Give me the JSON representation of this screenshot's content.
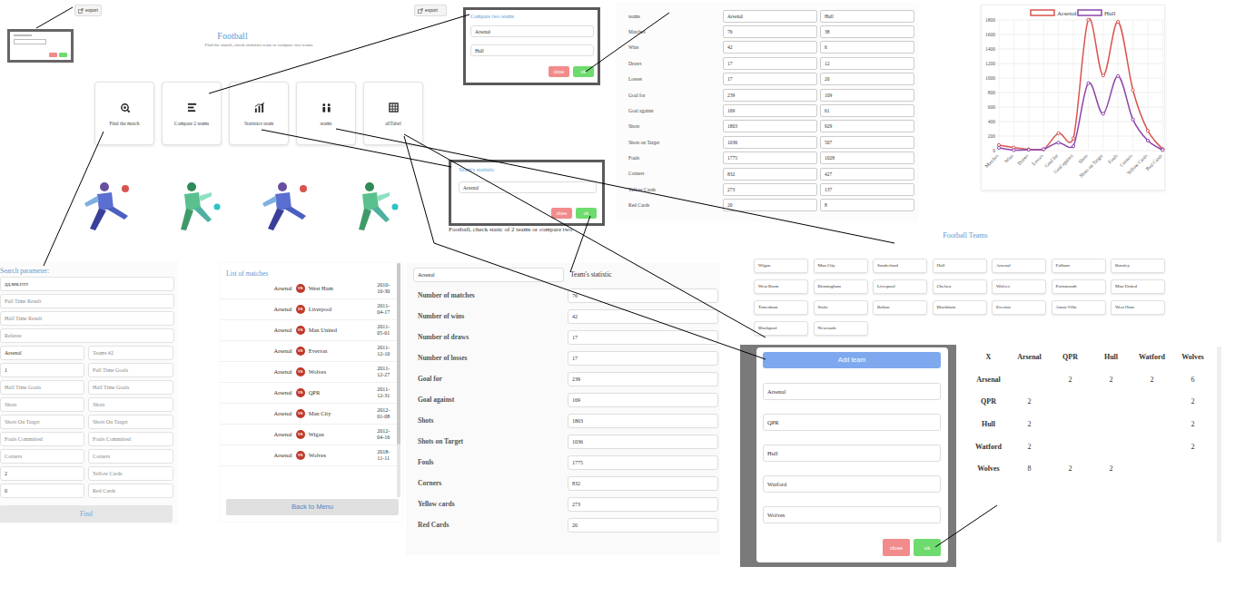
{
  "export_buttons": [
    "export",
    "export"
  ],
  "menu": {
    "title": "Football",
    "subtitle": "Find the match, check statistics team or compare two teams",
    "cards": [
      "Find the match",
      "Compare 2 teams",
      "Statistics team",
      "teams",
      "allTabel"
    ]
  },
  "compare_dialog": {
    "title": "Compare two teams",
    "fields": [
      "Arsenal",
      "Hull"
    ],
    "buttons": [
      "close",
      "ok"
    ]
  },
  "compare_table": {
    "rows": [
      {
        "label": "teams",
        "values": [
          "Arsenal",
          "Hull"
        ]
      },
      {
        "label": "Matches",
        "values": [
          "76",
          "38"
        ]
      },
      {
        "label": "Wins",
        "values": [
          "42",
          "6"
        ]
      },
      {
        "label": "Draws",
        "values": [
          "17",
          "12"
        ]
      },
      {
        "label": "Losses",
        "values": [
          "17",
          "20"
        ]
      },
      {
        "label": "Goal for",
        "values": [
          "239",
          "109"
        ]
      },
      {
        "label": "Goal against",
        "values": [
          "169",
          "61"
        ]
      },
      {
        "label": "Shots",
        "values": [
          "1803",
          "929"
        ]
      },
      {
        "label": "Shots on Target",
        "values": [
          "1036",
          "507"
        ]
      },
      {
        "label": "Fouls",
        "values": [
          "1775",
          "1028"
        ]
      },
      {
        "label": "Corners",
        "values": [
          "832",
          "427"
        ]
      },
      {
        "label": "Yellow Cards",
        "values": [
          "273",
          "137"
        ]
      },
      {
        "label": "Red Cards",
        "values": [
          "20",
          "8"
        ]
      }
    ]
  },
  "chart": {
    "y_ticks": [
      "0",
      "200",
      "400",
      "600",
      "800",
      "1000",
      "1200",
      "1400",
      "1600",
      "1800"
    ],
    "categories": [
      "Matches",
      "Wins",
      "Draws",
      "Losses",
      "Goal for",
      "Goal against",
      "Shots",
      "Shots on Target",
      "Fouls",
      "Corners",
      "Yellow Cards",
      "Red Cards"
    ],
    "series": [
      {
        "name": "Arsenal",
        "color": "#d9534f",
        "values": [
          76,
          42,
          17,
          17,
          239,
          169,
          1803,
          1036,
          1775,
          832,
          273,
          20
        ]
      },
      {
        "name": "Hull",
        "color": "#8e44ad",
        "values": [
          38,
          6,
          12,
          20,
          109,
          61,
          929,
          507,
          1028,
          427,
          137,
          8
        ]
      }
    ]
  },
  "stat_dialog": {
    "title": "Team's statistic",
    "field": "Arsenal",
    "buttons": [
      "close",
      "ok"
    ],
    "behind_text": "Football, check static of 2 teams or compare two"
  },
  "search": {
    "title": "Search parameter:",
    "wide_fields": [
      {
        "value": "дд.мм.гггг"
      },
      {
        "placeholder": "Full Time Result"
      },
      {
        "placeholder": "Half Time Result"
      },
      {
        "placeholder": "Referee"
      }
    ],
    "pairs": [
      [
        {
          "value": "Arsenal"
        },
        {
          "placeholder": "Teams #2"
        }
      ],
      [
        {
          "value": "1"
        },
        {
          "placeholder": "Full Time Goals"
        }
      ],
      [
        {
          "placeholder": "Half Time Goals"
        },
        {
          "placeholder": "Half Time Goals"
        }
      ],
      [
        {
          "placeholder": "Shots"
        },
        {
          "placeholder": "Shots"
        }
      ],
      [
        {
          "placeholder": "Shots On Target"
        },
        {
          "placeholder": "Shots On Target"
        }
      ],
      [
        {
          "placeholder": "Fouls Committed"
        },
        {
          "placeholder": "Fouls Committed"
        }
      ],
      [
        {
          "placeholder": "Corners"
        },
        {
          "placeholder": "Corners"
        }
      ],
      [
        {
          "value": "2"
        },
        {
          "placeholder": "Yellow Cards"
        }
      ],
      [
        {
          "value": "0"
        },
        {
          "placeholder": "Red Cards"
        }
      ]
    ],
    "button": "Find"
  },
  "matches": {
    "title": "List of matches",
    "button": "Back to Menu",
    "rows": [
      {
        "home": "Arsenal",
        "badge": "VS",
        "away": "West Ham",
        "date": "2010-10-30"
      },
      {
        "home": "Arsenal",
        "badge": "VS",
        "away": "Liverpool",
        "date": "2011-04-17"
      },
      {
        "home": "Arsenal",
        "badge": "VS",
        "away": "Man United",
        "date": "2011-05-01"
      },
      {
        "home": "Arsenal",
        "badge": "VS",
        "away": "Everton",
        "date": "2011-12-10"
      },
      {
        "home": "Arsenal",
        "badge": "VS",
        "away": "Wolves",
        "date": "2011-12-27"
      },
      {
        "home": "Arsenal",
        "badge": "VS",
        "away": "QPR",
        "date": "2011-12-31"
      },
      {
        "home": "Arsenal",
        "badge": "VS",
        "away": "Man City",
        "date": "2012-01-08"
      },
      {
        "home": "Arsenal",
        "badge": "VS",
        "away": "Wigan",
        "date": "2012-04-16"
      },
      {
        "home": "Arsenal",
        "badge": "VS",
        "away": "Wolves",
        "date": "2018-11-11"
      }
    ]
  },
  "team_stat": {
    "team": "Arsenal",
    "title": "Team's statistic",
    "rows": [
      {
        "label": "Number of matches",
        "value": "76"
      },
      {
        "label": "Number of wins",
        "value": "42"
      },
      {
        "label": "Number of draws",
        "value": "17"
      },
      {
        "label": "Number of losses",
        "value": "17"
      },
      {
        "label": "Goal for",
        "value": "239"
      },
      {
        "label": "Goal against",
        "value": "169"
      },
      {
        "label": "Shots",
        "value": "1803"
      },
      {
        "label": "Shots on Target",
        "value": "1036"
      },
      {
        "label": "Fouls",
        "value": "1775"
      },
      {
        "label": "Corners",
        "value": "832"
      },
      {
        "label": "Yellow cards",
        "value": "273"
      },
      {
        "label": "Red Cards",
        "value": "20"
      }
    ]
  },
  "teams_panel": {
    "title": "Football Teams",
    "teams": [
      "Wigan",
      "Man City",
      "Sunderland",
      "Hull",
      "Arsenal",
      "Fulham",
      "Burnley",
      "West Brom",
      "Birmingham",
      "Liverpool",
      "Chelsea",
      "Wolves",
      "Portsmouth",
      "Man United",
      "Tottenham",
      "Stoke",
      "Bolton",
      "Blackburn",
      "Everton",
      "Aston Villa",
      "West Ham",
      "Blackpool",
      "Newcastle"
    ]
  },
  "add_team": {
    "button": "Add team",
    "fields": [
      "Arsenal",
      "QPR",
      "Hull",
      "Watford",
      "Wolves"
    ],
    "buttons": [
      "close",
      "ok"
    ]
  },
  "table": {
    "columns": [
      "X",
      "Arsenal",
      "QPR",
      "Hull",
      "Watford",
      "Wolves"
    ],
    "rows": [
      [
        "Arsenal",
        "",
        "2",
        "2",
        "2",
        "6"
      ],
      [
        "QPR",
        "2",
        "",
        "",
        "",
        "2"
      ],
      [
        "Hull",
        "2",
        "",
        "",
        "",
        "2"
      ],
      [
        "Watford",
        "2",
        "",
        "",
        "",
        "2"
      ],
      [
        "Wolves",
        "8",
        "2",
        "2",
        "",
        ""
      ]
    ]
  }
}
